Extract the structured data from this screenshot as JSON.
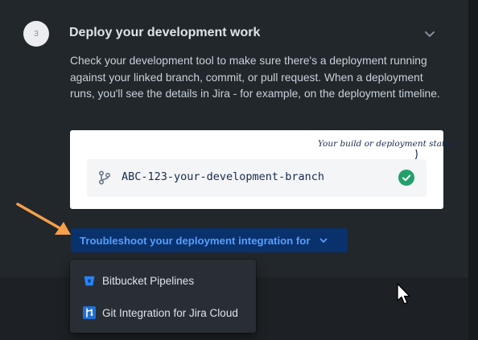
{
  "step": {
    "number": "3",
    "title": "Deploy your development work",
    "description": "Check your development tool to make sure there's a deployment running against your linked branch, commit, or pull request. When a deployment runs, you'll see the details in Jira - for example, on the deployment timeline."
  },
  "card": {
    "note": "Your build or deployment status",
    "branch_name": "ABC-123-your-development-branch"
  },
  "troubleshoot": {
    "label": "Troubleshoot your deployment integration for"
  },
  "dropdown": {
    "items": [
      {
        "label": "Bitbucket Pipelines",
        "icon": "bitbucket-icon"
      },
      {
        "label": "Git Integration for Jira Cloud",
        "icon": "git-integration-icon"
      }
    ]
  },
  "colors": {
    "panel_bg": "#22272b",
    "page_bg": "#1d2125",
    "button_bg": "#09326c",
    "link_blue": "#579dff",
    "success_green": "#22a06b",
    "arrow_orange": "#f5a04a"
  }
}
